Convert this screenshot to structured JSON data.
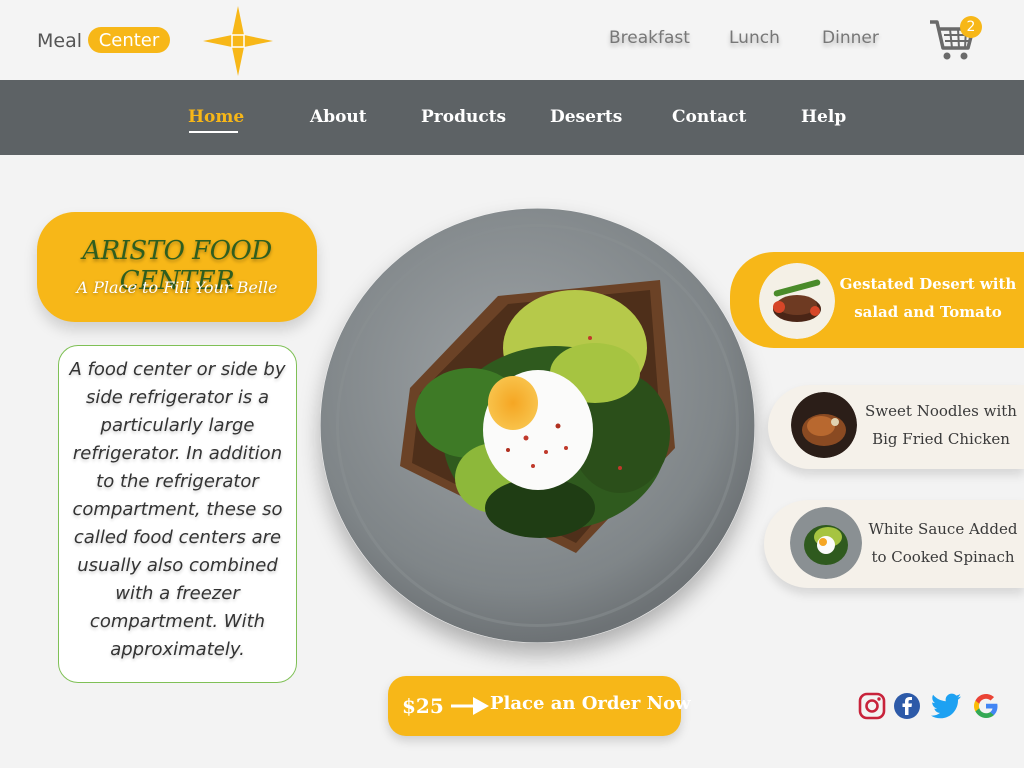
{
  "logo": {
    "word1": "Meal",
    "word2": "Center"
  },
  "top_nav": [
    {
      "label": "Breakfast"
    },
    {
      "label": "Lunch"
    },
    {
      "label": "Dinner"
    }
  ],
  "cart": {
    "count": "2"
  },
  "main_nav": [
    {
      "label": "Home",
      "active": true
    },
    {
      "label": "About"
    },
    {
      "label": "Products"
    },
    {
      "label": "Deserts"
    },
    {
      "label": "Contact"
    },
    {
      "label": "Help"
    }
  ],
  "hero": {
    "title": "ARISTO FOOD CENTER",
    "subtitle": "A Place to Fill Your Belle",
    "description": "A food center or side by side refrigerator is a particularly large refrigerator. In addition to the refrigerator compartment, these so called food centers are usually also combined with a freezer compartment. With approximately."
  },
  "featured": [
    {
      "line1": "Gestated Desert with",
      "line2": "salad and Tomato"
    },
    {
      "line1": "Sweet Noodles with",
      "line2": "Big Fried Chicken"
    },
    {
      "line1": "White Sauce Added",
      "line2": "to Cooked Spinach"
    }
  ],
  "order": {
    "price": "$25",
    "label": "Place an Order Now"
  },
  "social_icons": [
    "instagram-icon",
    "facebook-icon",
    "twitter-icon",
    "google-icon"
  ],
  "colors": {
    "accent": "#f7b718",
    "nav_bg": "#5d6265",
    "title_green": "#2f5e1f",
    "border_green": "#7fc056"
  }
}
